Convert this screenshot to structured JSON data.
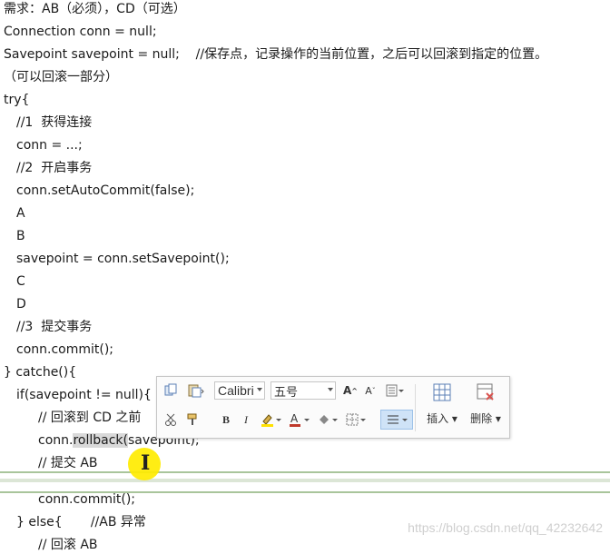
{
  "doc": {
    "lines": [
      "需求：AB（必须），CD（可选）",
      "Connection conn = null;",
      "Savepoint savepoint = null;    //保存点，记录操作的当前位置，之后可以回滚到指定的位置。",
      "（可以回滚一部分）",
      "try{",
      "//1  获得连接",
      "conn = ...;",
      "//2  开启事务",
      "conn.setAutoCommit(false);",
      "A",
      "B",
      "savepoint = conn.setSavepoint();",
      "C",
      "D",
      "//3  提交事务",
      "conn.commit();",
      "} catche(){",
      "if(savepoint != null){",
      "// 回滚到 CD 之前",
      "conn.",
      "rollback(",
      "savepoint);",
      "// 提交 AB",
      "conn.commit();",
      "} else{       //AB 异常",
      "// 回滚 AB"
    ]
  },
  "mini_toolbar": {
    "font_name": "Calibri",
    "font_size": "五号",
    "insert_label": "插入",
    "delete_label": "删除"
  },
  "watermark": "https://blog.csdn.net/qq_42232642"
}
